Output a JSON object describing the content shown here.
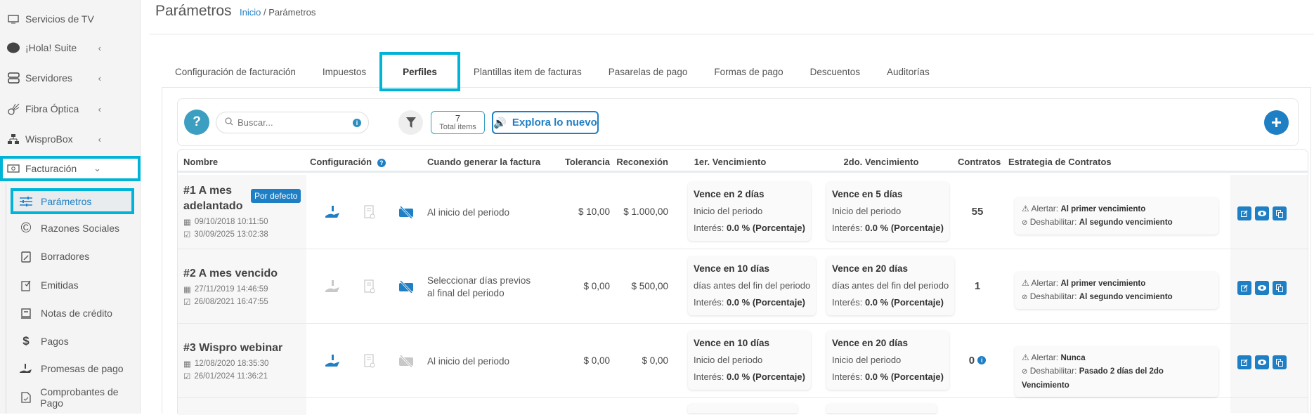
{
  "sidebar": {
    "items": [
      {
        "label": "Servicios de TV",
        "icon": "tv-icon"
      },
      {
        "label": "¡Hola! Suite",
        "icon": "hola-icon",
        "chevron": "‹"
      },
      {
        "label": "Servidores",
        "icon": "server-icon",
        "chevron": "‹"
      },
      {
        "label": "Fibra Óptica",
        "icon": "fiber-icon",
        "chevron": "‹"
      },
      {
        "label": "WisproBox",
        "icon": "network-icon",
        "chevron": "‹"
      },
      {
        "label": "Facturación",
        "icon": "money-icon",
        "chevron": "⌄"
      },
      {
        "label": "Parámetros",
        "icon": "sliders-icon"
      },
      {
        "label": "Razones Sociales",
        "icon": "copyright-icon"
      },
      {
        "label": "Borradores",
        "icon": "draft-icon"
      },
      {
        "label": "Emitidas",
        "icon": "issued-icon"
      },
      {
        "label": "Notas de crédito",
        "icon": "credit-note-icon"
      },
      {
        "label": "Pagos",
        "icon": "dollar-icon"
      },
      {
        "label": "Promesas de pago",
        "icon": "hand-dollar-icon"
      },
      {
        "label": "Comprobantes de Pago",
        "icon": "receipt-icon"
      }
    ]
  },
  "header": {
    "title": "Parámetros",
    "breadcrumb_home": "Inicio",
    "breadcrumb_sep": " / ",
    "breadcrumb_current": "Parámetros"
  },
  "tabs": [
    "Configuración de facturación",
    "Impuestos",
    "Perfiles",
    "Plantillas item de facturas",
    "Pasarelas de pago",
    "Formas de pago",
    "Descuentos",
    "Auditorías"
  ],
  "active_tab": "Perfiles",
  "toolbar": {
    "help": "?",
    "search_placeholder": "Buscar...",
    "total_count": "7",
    "total_label": "Total items",
    "explore": "Explora lo nuevo",
    "add": "+"
  },
  "table": {
    "headers": {
      "nombre": "Nombre",
      "config": "Configuración",
      "cuando": "Cuando generar la factura",
      "tolerancia": "Tolerancia",
      "reconexion": "Reconexión",
      "v1": "1er. Vencimiento",
      "v2": "2do. Vencimiento",
      "contratos": "Contratos",
      "estrategia": "Estrategia de Contratos"
    },
    "rows": [
      {
        "name": "#1 A mes adelantado",
        "badge": "Por defecto",
        "created": "09/10/2018 10:11:50",
        "updated": "30/09/2025 13:02:38",
        "config_active": [
          true,
          false,
          true
        ],
        "cuando": "Al inicio del periodo",
        "tolerancia": "$ 10,00",
        "reconexion": "$ 1.000,00",
        "v1": {
          "title": "Vence en 2 días",
          "ref": "Inicio del periodo",
          "interes_label": "Interés: ",
          "interes": "0.0 % (Porcentaje)"
        },
        "v2": {
          "title": "Vence en 5 días",
          "ref": "Inicio del periodo",
          "interes_label": "Interés: ",
          "interes": "0.0 % (Porcentaje)"
        },
        "contratos": "55",
        "alertar_label": "Alertar: ",
        "alertar": "Al primer vencimiento",
        "deshabilitar_label": "Deshabilitar: ",
        "deshabilitar": "Al segundo vencimiento"
      },
      {
        "name": "#2 A mes vencido",
        "badge": "",
        "created": "27/11/2019 14:46:59",
        "updated": "26/08/2021 16:47:55",
        "config_active": [
          false,
          false,
          true
        ],
        "cuando": "Seleccionar días previos al final del periodo",
        "tolerancia": "$ 0,00",
        "reconexion": "$ 500,00",
        "v1": {
          "title": "Vence en 10 días",
          "ref": "días antes del fin del periodo",
          "interes_label": "Interés: ",
          "interes": "0.0 % (Porcentaje)"
        },
        "v2": {
          "title": "Vence en 20 días",
          "ref": "días antes del fin del periodo",
          "interes_label": "Interés: ",
          "interes": "0.0 % (Porcentaje)"
        },
        "contratos": "1",
        "alertar_label": "Alertar: ",
        "alertar": "Al primer vencimiento",
        "deshabilitar_label": "Deshabilitar: ",
        "deshabilitar": "Al segundo vencimiento"
      },
      {
        "name": "#3 Wispro webinar",
        "badge": "",
        "created": "12/08/2020 18:35:30",
        "updated": "26/01/2024 11:36:21",
        "config_active": [
          true,
          false,
          false
        ],
        "cuando": "Al inicio del periodo",
        "tolerancia": "$ 0,00",
        "reconexion": "$ 0,00",
        "v1": {
          "title": "Vence en 10 días",
          "ref": "Inicio del periodo",
          "interes_label": "Interés: ",
          "interes": "0.0 % (Porcentaje)"
        },
        "v2": {
          "title": "Vence en 20 días",
          "ref": "Inicio del periodo",
          "interes_label": "Interés: ",
          "interes": "0.0 % (Porcentaje)"
        },
        "contratos": "0",
        "contratos_info": true,
        "alertar_label": "Alertar: ",
        "alertar": "Nunca",
        "deshabilitar_label": "Deshabilitar: ",
        "deshabilitar": "Pasado 2 días del 2do Vencimiento"
      }
    ]
  },
  "colors": {
    "accent": "#1f7fc4",
    "highlight": "#00b4d8",
    "help": "#3c9ec0",
    "inactive_icon": "#c8c8c8"
  }
}
